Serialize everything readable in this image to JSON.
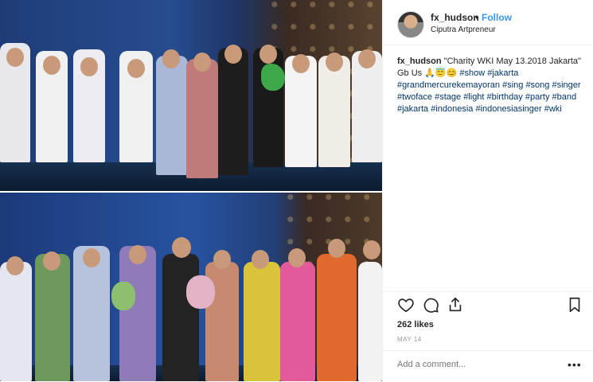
{
  "post": {
    "username": "fx_hudson",
    "separator": "•",
    "follow_label": "Follow",
    "location": "Ciputra Artpreneur"
  },
  "caption": {
    "username": "fx_hudson",
    "text": "\"Charity WKI May 13.2018 Jakarta\" Gb Us 🙏😇😊",
    "hashtags": [
      "#show",
      "#jakarta",
      "#grandmercurekemayoran",
      "#sing",
      "#song",
      "#singer",
      "#twoface",
      "#stage",
      "#light",
      "#birthday",
      "#party",
      "#band",
      "#jakarta",
      "#indonesia",
      "#indonesiasinger",
      "#wki"
    ]
  },
  "actions": {
    "icons": [
      "heart-icon",
      "comment-icon",
      "share-icon",
      "bookmark-icon"
    ]
  },
  "likes": "262 likes",
  "date": "MAY 14",
  "comment": {
    "placeholder": "Add a comment..."
  },
  "more_label": "•••",
  "colors": {
    "follow": "#3897f0",
    "hashtag": "#003569",
    "muted": "#999999",
    "border": "#efefef"
  }
}
